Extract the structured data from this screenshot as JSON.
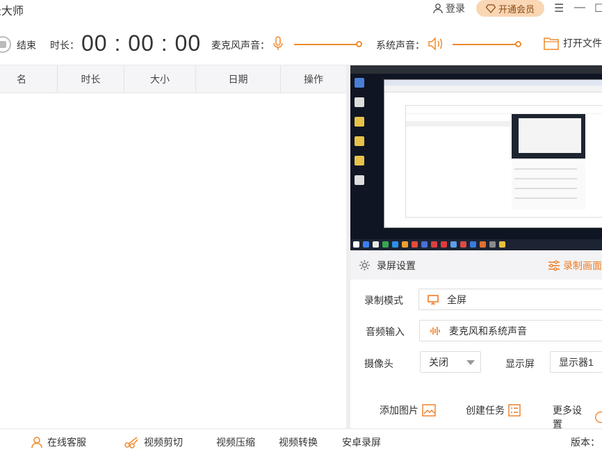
{
  "title": "录大师",
  "header": {
    "login": "登录",
    "vip": "开通会员"
  },
  "toolbar": {
    "stop": "结束",
    "duration_label": "时长：",
    "timer": "00 : 00 : 00",
    "mic_label": "麦克风声音：",
    "sys_label": "系统声音：",
    "open_file": "打开文件"
  },
  "table": {
    "columns": [
      "名",
      "时长",
      "大小",
      "日期",
      "操作"
    ]
  },
  "settings": {
    "title": "录屏设置",
    "area": "录制画面",
    "mode_label": "录制模式",
    "mode_value": "全屏",
    "audio_label": "音频输入",
    "audio_value": "麦克风和系统声音",
    "camera_label": "摄像头",
    "camera_value": "关闭",
    "display_label": "显示屏",
    "display_value": "显示器1",
    "add_image": "添加图片",
    "create_task": "创建任务",
    "more_settings": "更多设置"
  },
  "footer": {
    "service": "在线客服",
    "edit": "视频剪切",
    "compress": "视频压缩",
    "convert": "视频转换",
    "android": "安卓录屏",
    "version": "版本："
  },
  "colors": {
    "accent": "#f08a2c",
    "vip_bg": "#f9d6b4"
  }
}
